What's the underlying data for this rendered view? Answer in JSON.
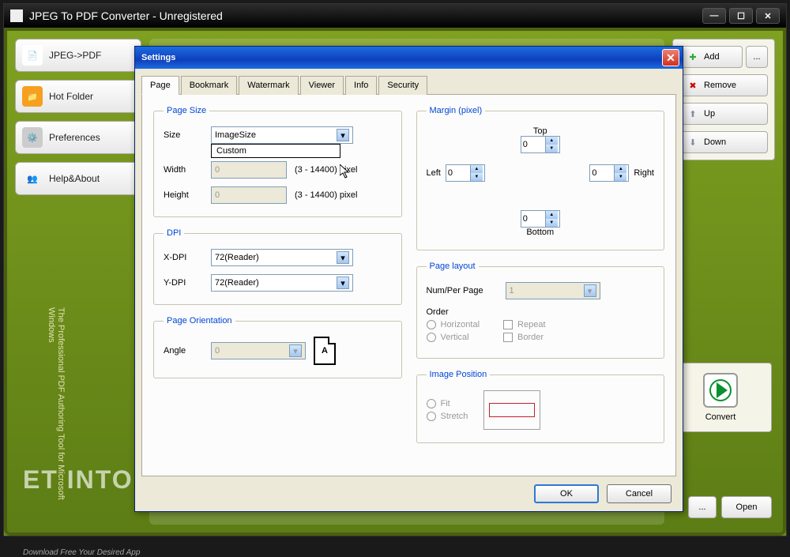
{
  "app": {
    "title": "JPEG To PDF Converter - Unregistered"
  },
  "sidebar": {
    "items": [
      {
        "label": "JPEG->PDF"
      },
      {
        "label": "Hot Folder"
      },
      {
        "label": "Preferences"
      },
      {
        "label": "Help&About"
      }
    ]
  },
  "rightbar": {
    "add": "Add",
    "more": "...",
    "remove": "Remove",
    "up": "Up",
    "down": "Down"
  },
  "convert": {
    "label": "Convert"
  },
  "dialog": {
    "title": "Settings",
    "tabs": [
      "Page",
      "Bookmark",
      "Watermark",
      "Viewer",
      "Info",
      "Security"
    ],
    "active_tab": 0,
    "pagesize": {
      "legend": "Page Size",
      "size_label": "Size",
      "size_value": "ImageSize",
      "dropdown_option": "Custom",
      "width_label": "Width",
      "width_value": "0",
      "height_label": "Height",
      "height_value": "0",
      "hint": "(3 - 14400) pixel"
    },
    "dpi": {
      "legend": "DPI",
      "x_label": "X-DPI",
      "x_value": "72(Reader)",
      "y_label": "Y-DPI",
      "y_value": "72(Reader)"
    },
    "orientation": {
      "legend": "Page Orientation",
      "angle_label": "Angle",
      "angle_value": "0",
      "icon_letter": "A"
    },
    "margin": {
      "legend": "Margin (pixel)",
      "top_label": "Top",
      "top_value": "0",
      "left_label": "Left",
      "left_value": "0",
      "right_label": "Right",
      "right_value": "0",
      "bottom_label": "Bottom",
      "bottom_value": "0"
    },
    "layout": {
      "legend": "Page layout",
      "num_label": "Num/Per Page",
      "num_value": "1",
      "order_label": "Order",
      "horizontal": "Horizontal",
      "vertical": "Vertical",
      "repeat": "Repeat",
      "border": "Border"
    },
    "imgpos": {
      "legend": "Image Position",
      "fit": "Fit",
      "stretch": "Stretch"
    },
    "ok": "OK",
    "cancel": "Cancel"
  },
  "bottom": {
    "more": "...",
    "open": "Open"
  },
  "vertical_text": "The Professional PDF Authoring Tool\n for Microsoft Windows",
  "watermark_main": "ET INTO PC",
  "watermark_sub": "Download Free Your Desired App"
}
